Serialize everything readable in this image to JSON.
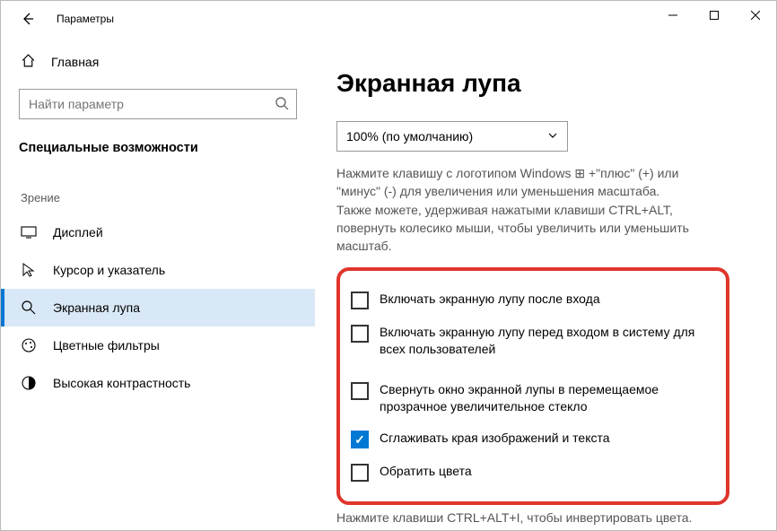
{
  "window": {
    "title": "Параметры"
  },
  "sidebar": {
    "home": "Главная",
    "search_placeholder": "Найти параметр",
    "section": "Специальные возможности",
    "group": "Зрение",
    "items": [
      {
        "label": "Дисплей"
      },
      {
        "label": "Курсор и указатель"
      },
      {
        "label": "Экранная лупа"
      },
      {
        "label": "Цветные фильтры"
      },
      {
        "label": "Высокая контрастность"
      }
    ]
  },
  "content": {
    "title": "Экранная лупа",
    "zoom_select": "100% (по умолчанию)",
    "hint1": "Нажмите клавишу с логотипом Windows ⊞ +\"плюс\" (+) или \"минус\" (-) для увеличения или уменьшения масштаба.",
    "hint2": "Также можете, удерживая нажатыми клавиши CTRL+ALT, повернуть колесико мыши, чтобы увеличить или уменьшить масштаб.",
    "checks": {
      "c1": "Включать экранную лупу после входа",
      "c2": "Включать экранную лупу перед входом в систему для всех пользователей",
      "c3": "Свернуть окно экранной лупы в перемещаемое прозрачное увеличительное стекло",
      "c4": "Сглаживать края изображений и текста",
      "c5": "Обратить цвета"
    },
    "footer": "Нажмите клавиши CTRL+ALT+I, чтобы инвертировать цвета."
  }
}
